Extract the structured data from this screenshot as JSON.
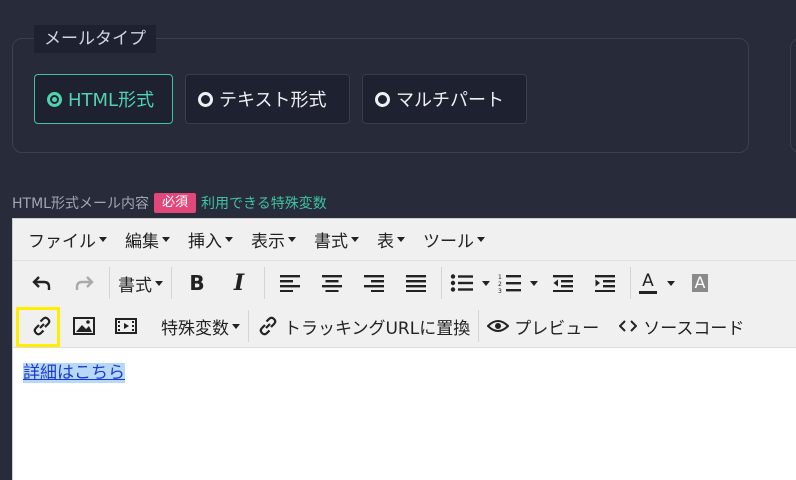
{
  "mail_type": {
    "legend": "メールタイプ",
    "options": [
      {
        "label": "HTML形式",
        "selected": true
      },
      {
        "label": "テキスト形式",
        "selected": false
      },
      {
        "label": "マルチパート",
        "selected": false
      }
    ]
  },
  "content_label": {
    "title": "HTML形式メール内容",
    "required": "必須",
    "vars_link": "利用できる特殊変数"
  },
  "editor": {
    "menus": [
      "ファイル",
      "編集",
      "挿入",
      "表示",
      "書式",
      "表",
      "ツール"
    ],
    "toolbar": {
      "format_label": "書式",
      "bold": "B",
      "italic": "I",
      "text_color": "A",
      "bg_color": "A",
      "special_vars": "特殊変数",
      "tracking_url": "トラッキングURLに置換",
      "preview": "プレビュー",
      "source_code": "ソースコード"
    },
    "body_link_text": "詳細はこちら"
  },
  "colors": {
    "accent": "#3fc3a0",
    "required_badge": "#e2477a",
    "highlight": "#ffee00"
  }
}
